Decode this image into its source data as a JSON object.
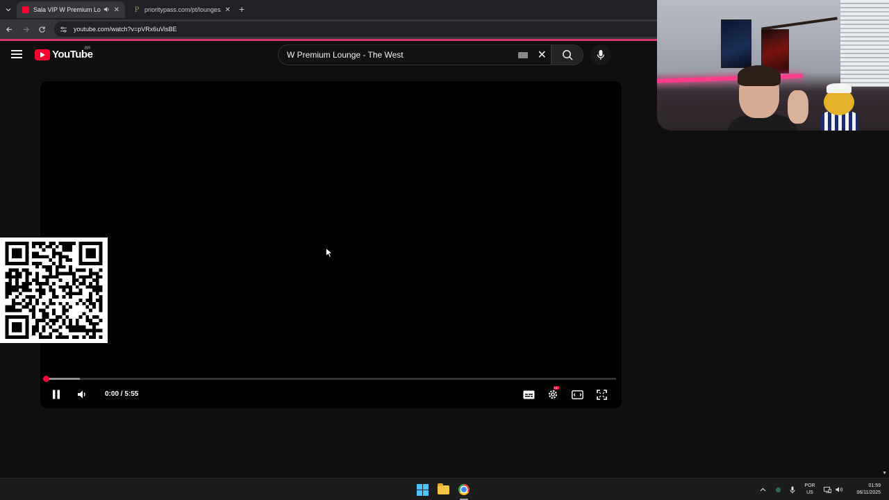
{
  "browser": {
    "tabs": [
      {
        "title": "Sala VIP W Premium Lounge",
        "active": true
      },
      {
        "title": "prioritypass.com/pt/lounges/br",
        "active": false
      }
    ],
    "url": "youtube.com/watch?v=pVRx6uVisBE"
  },
  "youtube": {
    "logo_text": "YouTube",
    "country_code": "BR",
    "search_value": "W Premium Lounge - The West"
  },
  "player": {
    "time": "0:00 / 5:55",
    "progress_fraction": 0.0,
    "buffered_fraction": 0.06,
    "hd_badge": "HD"
  },
  "taskbar": {
    "language_line1": "POR",
    "language_line2": "US",
    "time": "01:59",
    "date": "06/11/2025"
  },
  "colors": {
    "youtube_red": "#ff0033",
    "accent_pink": "#d6336c",
    "background": "#0f0f0f"
  }
}
